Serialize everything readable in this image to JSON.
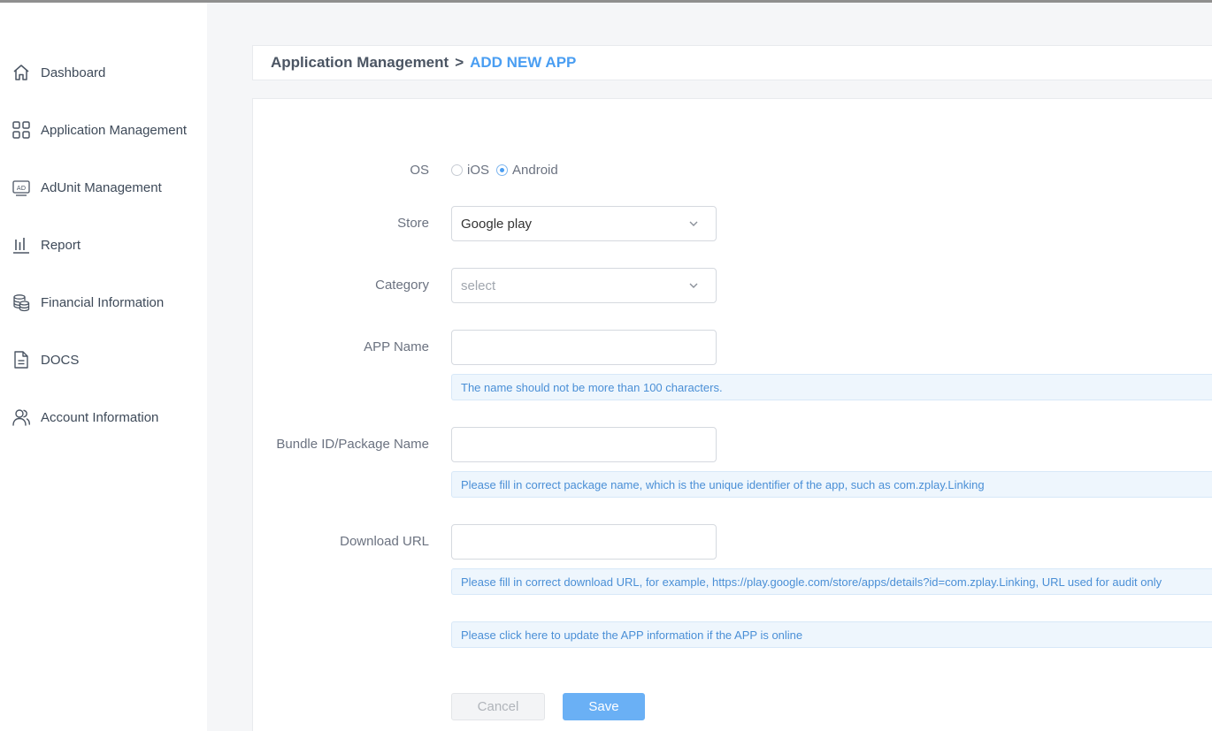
{
  "sidebar": {
    "items": [
      {
        "label": "Dashboard",
        "icon": "home-icon"
      },
      {
        "label": "Application Management",
        "icon": "grid-icon"
      },
      {
        "label": "AdUnit Management",
        "icon": "ad-icon"
      },
      {
        "label": "Report",
        "icon": "bar-chart-icon"
      },
      {
        "label": "Financial Information",
        "icon": "coins-stack-icon"
      },
      {
        "label": "DOCS",
        "icon": "document-icon"
      },
      {
        "label": "Account Information",
        "icon": "users-icon"
      }
    ],
    "ad_icon_text": "AD"
  },
  "breadcrumb": {
    "parent": "Application Management",
    "separator": ">",
    "current": "ADD NEW APP"
  },
  "form": {
    "os": {
      "label": "OS",
      "options": [
        "iOS",
        "Android"
      ],
      "selected": "Android"
    },
    "store": {
      "label": "Store",
      "value": "Google play"
    },
    "category": {
      "label": "Category",
      "placeholder": "select"
    },
    "app_name": {
      "label": "APP Name",
      "value": "",
      "hint": "The name should not be more than 100 characters."
    },
    "bundle_id": {
      "label": "Bundle ID/Package Name",
      "value": "",
      "hint": "Please fill in correct package name, which is the unique identifier of the app, such as com.zplay.Linking"
    },
    "download_url": {
      "label": "Download URL",
      "value": "",
      "hint": "Please fill in correct download URL, for example, https://play.google.com/store/apps/details?id=com.zplay.Linking, URL used for audit only"
    },
    "update_notice": "Please click here to update the APP information if the APP is online",
    "cancel_label": "Cancel",
    "save_label": "Save"
  },
  "colors": {
    "accent": "#4a9ef2",
    "save_button": "#6ab0f5",
    "hint_background": "#eef6fd"
  }
}
